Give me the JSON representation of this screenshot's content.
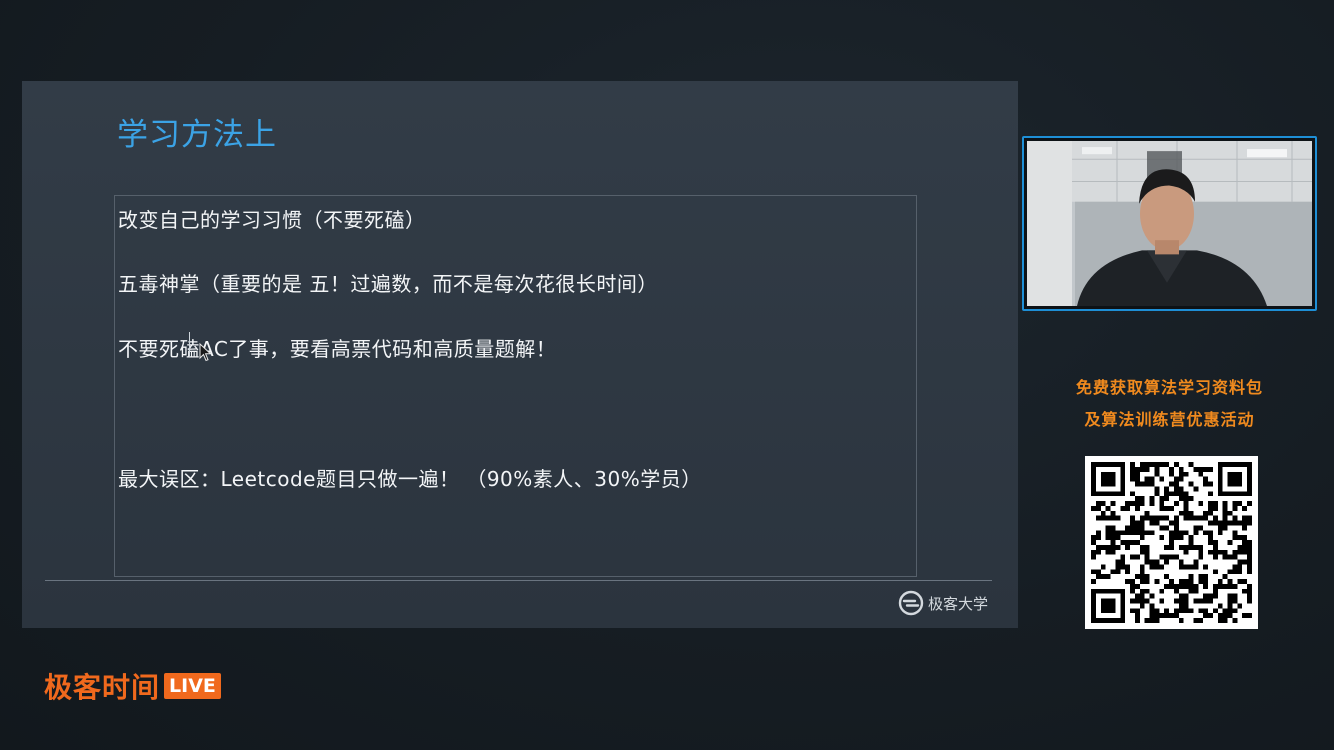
{
  "slide": {
    "title": "学习方法上",
    "lines": [
      "改变自己的学习习惯（不要死磕）",
      "五毒神掌（重要的是 五！过遍数，而不是每次花很长时间）",
      "不要死磕AC了事，要看高票代码和高质量题解！",
      "最大误区：Leetcode题目只做一遍！ （90%素人、30%学员）"
    ],
    "logo_text": "极客大学"
  },
  "promo": {
    "line1": "免费获取算法学习资料包",
    "line2": "及算法训练营优惠活动"
  },
  "brand": {
    "name": "极客时间",
    "badge": "LIVE"
  },
  "colors": {
    "title_blue": "#3ba3e6",
    "accent_orange": "#f0691d",
    "promo_orange": "#f08a1e",
    "camera_border": "#1e8fd6"
  }
}
